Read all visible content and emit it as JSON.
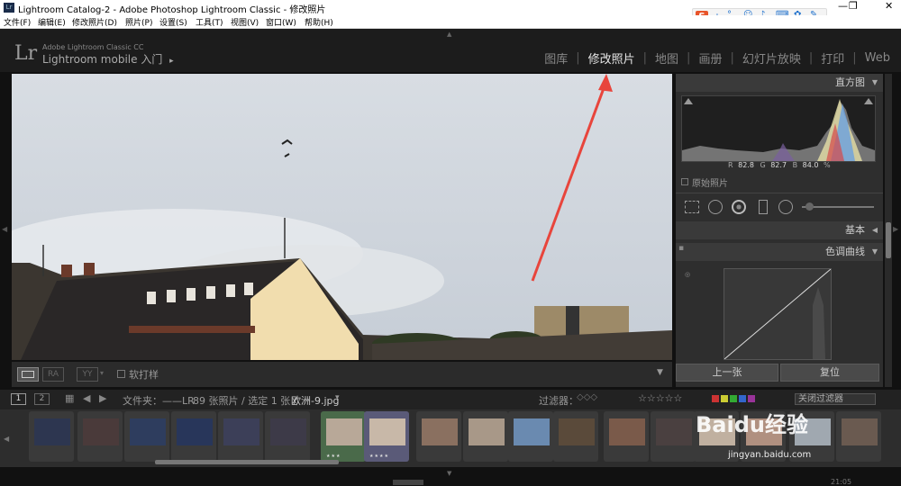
{
  "window": {
    "title": "Lightroom Catalog-2 - Adobe Photoshop Lightroom Classic - 修改照片",
    "controls": [
      "—",
      "❐",
      "✕"
    ]
  },
  "menu": [
    "文件(F)",
    "编辑(E)",
    "修改照片(D)",
    "照片(P)",
    "设置(S)",
    "工具(T)",
    "视图(V)",
    "窗口(W)",
    "帮助(H)"
  ],
  "ime": {
    "logo": "S",
    "label": "中"
  },
  "identity": {
    "logo": "Lr",
    "line1": "Adobe Lightroom Classic CC",
    "line2": "Lightroom mobile 入门",
    "arrow": "▸"
  },
  "modules": [
    "图库",
    "修改照片",
    "地图",
    "画册",
    "幻灯片放映",
    "打印",
    "Web"
  ],
  "active_module": "修改照片",
  "photo_toolbar": {
    "soft_proof": "软打样"
  },
  "histogram": {
    "title": "直方图",
    "readout_r_label": "R",
    "readout_r": "82.8",
    "readout_g_label": "G",
    "readout_g": "82.7",
    "readout_b_label": "B",
    "readout_b": "84.0",
    "readout_unit": "%",
    "original_photo": "原始照片"
  },
  "panels": {
    "basic": "基本",
    "tone_curve": "色调曲线"
  },
  "buttons": {
    "previous": "上一张",
    "reset": "复位"
  },
  "filmstrip_bar": {
    "page1": "1",
    "page2": "2",
    "source": "文件夹：——LR",
    "count": "89 张照片 / 选定 1 张 /",
    "file": "欧洲-9.jpg",
    "filter_label": "过滤器：",
    "stars": "☆☆☆☆☆",
    "filter_off": "关闭过滤器"
  },
  "thumbs": [
    {
      "color": "#2d3650",
      "stars": ""
    },
    {
      "color": "#4a3a3a",
      "stars": ""
    },
    {
      "color": "#2e3d5e",
      "stars": ""
    },
    {
      "color": "#28365a",
      "stars": ""
    },
    {
      "color": "#3c3f58",
      "stars": ""
    },
    {
      "color": "#3d3a48",
      "stars": ""
    },
    {
      "color": "#b8a898",
      "stars": "★★★",
      "selected": true
    },
    {
      "color": "#c8b8a8",
      "stars": "★★★★",
      "selected": true
    },
    {
      "color": "#8a7060",
      "stars": ""
    },
    {
      "color": "#a89888",
      "stars": ""
    },
    {
      "color": "#6a8ab0",
      "stars": ""
    },
    {
      "color": "#5a4a3a",
      "stars": ""
    },
    {
      "color": "#7a5a4a",
      "stars": ""
    },
    {
      "color": "#4a4040",
      "stars": ""
    },
    {
      "color": "#c0b0a0",
      "stars": ""
    },
    {
      "color": "#b09080",
      "stars": ""
    },
    {
      "color": "#a0a8b0",
      "stars": ""
    },
    {
      "color": "#6a5a50",
      "stars": ""
    }
  ],
  "watermark": {
    "brand": "Baidu经验",
    "url": "jingyan.baidu.com"
  },
  "clock": "21:05",
  "accent": "#e8453c"
}
